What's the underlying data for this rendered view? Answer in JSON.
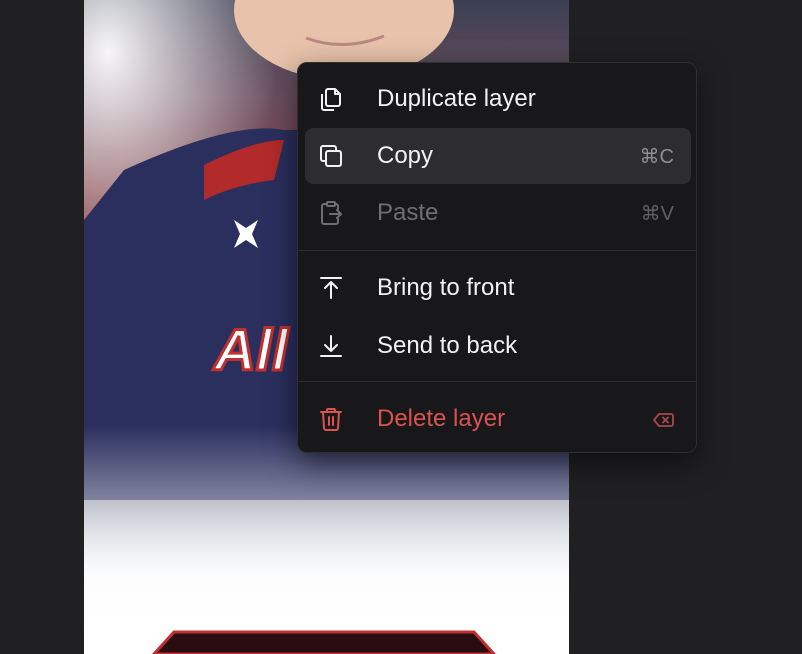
{
  "menu": {
    "items": [
      {
        "label": "Duplicate layer",
        "icon": "duplicate-icon",
        "shortcut": ""
      },
      {
        "label": "Copy",
        "icon": "copy-icon",
        "shortcut": "⌘C",
        "highlighted": true
      },
      {
        "label": "Paste",
        "icon": "paste-icon",
        "shortcut": "⌘V",
        "disabled": true
      },
      {
        "label": "Bring to front",
        "icon": "bring-to-front-icon",
        "shortcut": ""
      },
      {
        "label": "Send to back",
        "icon": "send-to-back-icon",
        "shortcut": ""
      },
      {
        "label": "Delete layer",
        "icon": "trash-icon",
        "shortcut_icon": "backspace-icon"
      }
    ]
  },
  "colors": {
    "background": "#202022",
    "menu": "#18181b",
    "highlight": "#2c2c31",
    "danger": "#d9534f"
  }
}
